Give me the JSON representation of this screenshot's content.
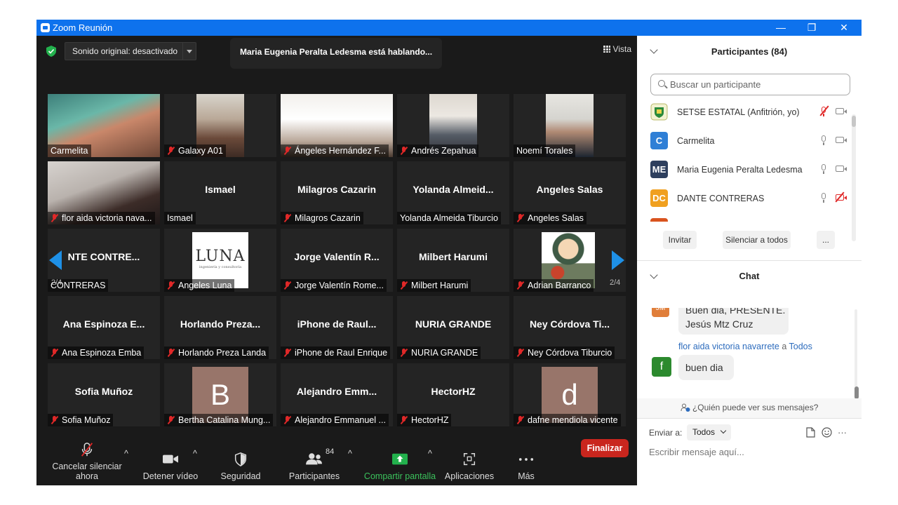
{
  "window": {
    "title": "Zoom Reunión",
    "controls": [
      "—",
      "❐",
      "✕"
    ]
  },
  "top": {
    "sound": "Sonido original: desactivado",
    "speaking": "Maria Eugenia Peralta Ledesma está hablando...",
    "view": "Vista"
  },
  "gallery": {
    "page_left": "2/4",
    "page_right": "2/4",
    "tiles": [
      {
        "big": "",
        "name": "Carmelita",
        "muted": false
      },
      {
        "big": "",
        "name": "Galaxy A01",
        "muted": true
      },
      {
        "big": "",
        "name": "Ángeles Hernández F...",
        "muted": true
      },
      {
        "big": "",
        "name": "Andrés Zepahua",
        "muted": true
      },
      {
        "big": "",
        "name": "Noemí Torales",
        "muted": false
      },
      {
        "big": "",
        "name": "flor aida victoria nava...",
        "muted": true
      },
      {
        "big": "Ismael",
        "name": "Ismael",
        "muted": false
      },
      {
        "big": "Milagros Cazarin",
        "name": "Milagros Cazarin",
        "muted": true
      },
      {
        "big": "Yolanda  Almeid...",
        "name": "Yolanda Almeida Tiburcio",
        "muted": false
      },
      {
        "big": "Angeles Salas",
        "name": "Angeles Salas",
        "muted": true
      },
      {
        "big": "NTE  CONTRE...",
        "name": "CONTRERAS",
        "muted": false
      },
      {
        "big": "",
        "name": "Angeles Luna",
        "muted": true,
        "logo": "LUNA",
        "logo_sub": "ingeniería y consultoría"
      },
      {
        "big": "Jorge Valentín R...",
        "name": "Jorge Valentín Rome...",
        "muted": true
      },
      {
        "big": "Milbert Harumi",
        "name": "Milbert Harumi",
        "muted": true
      },
      {
        "big": "",
        "name": "Adrian Barranco",
        "muted": true
      },
      {
        "big": "Ana  Espinoza  E...",
        "name": "Ana Espinoza Emba",
        "muted": true
      },
      {
        "big": "Horlando  Preza...",
        "name": "Horlando Preza Landa",
        "muted": true
      },
      {
        "big": "iPhone  de  Raul...",
        "name": "iPhone de Raul Enrique",
        "muted": true
      },
      {
        "big": "NURIA GRANDE",
        "name": "NURIA GRANDE",
        "muted": true
      },
      {
        "big": "Ney  Córdova  Ti...",
        "name": "Ney Córdova Tiburcio",
        "muted": true
      },
      {
        "big": "Sofia Muñoz",
        "name": "Sofia Muñoz",
        "muted": true
      },
      {
        "big": "",
        "name": "Bertha Catalina Mung...",
        "muted": true,
        "letter": "B"
      },
      {
        "big": "Alejandro  Emm...",
        "name": "Alejandro Emmanuel ...",
        "muted": true
      },
      {
        "big": "HectorHZ",
        "name": "HectorHZ",
        "muted": true
      },
      {
        "big": "",
        "name": "dafne mendiola vicente",
        "muted": true,
        "letter": "d"
      }
    ]
  },
  "toolbar": {
    "unmute": "Cancelar silenciar ahora",
    "video": "Detener vídeo",
    "security": "Seguridad",
    "participants": "Participantes",
    "participants_count": "84",
    "share": "Compartir pantalla",
    "apps": "Aplicaciones",
    "more": "Más",
    "end": "Finalizar"
  },
  "participants_panel": {
    "title": "Participantes (84)",
    "search_placeholder": "Buscar un participante",
    "rows": [
      {
        "initials": "",
        "name": "SETSE ESTATAL (Anfitrión, yo)",
        "color": "#f2f2d0"
      },
      {
        "initials": "C",
        "name": "Carmelita",
        "color": "#2f7fd6"
      },
      {
        "initials": "ME",
        "name": "Maria Eugenia Peralta Ledesma",
        "color": "#2e3f5e"
      },
      {
        "initials": "DC",
        "name": "DANTE CONTRERAS",
        "color": "#f0a020"
      }
    ],
    "invite": "Invitar",
    "mute_all": "Silenciar a todos",
    "more": "..."
  },
  "chat": {
    "title": "Chat",
    "msg1_avatar": "JM",
    "msg1_line1": "Buen dia, PRESENTE.",
    "msg1_line2": "Jesús Mtz Cruz",
    "msg2_sender": "flor aida victoria navarrete",
    "msg2_to_word": "a",
    "msg2_to": "Todos",
    "msg2_avatar": "f",
    "msg2_text": "buen dia",
    "privacy": "¿Quién puede ver sus mensajes?",
    "send_to_label": "Enviar a:",
    "send_to_value": "Todos",
    "input_placeholder": "Escribir mensaje aquí...",
    "more": "···"
  }
}
